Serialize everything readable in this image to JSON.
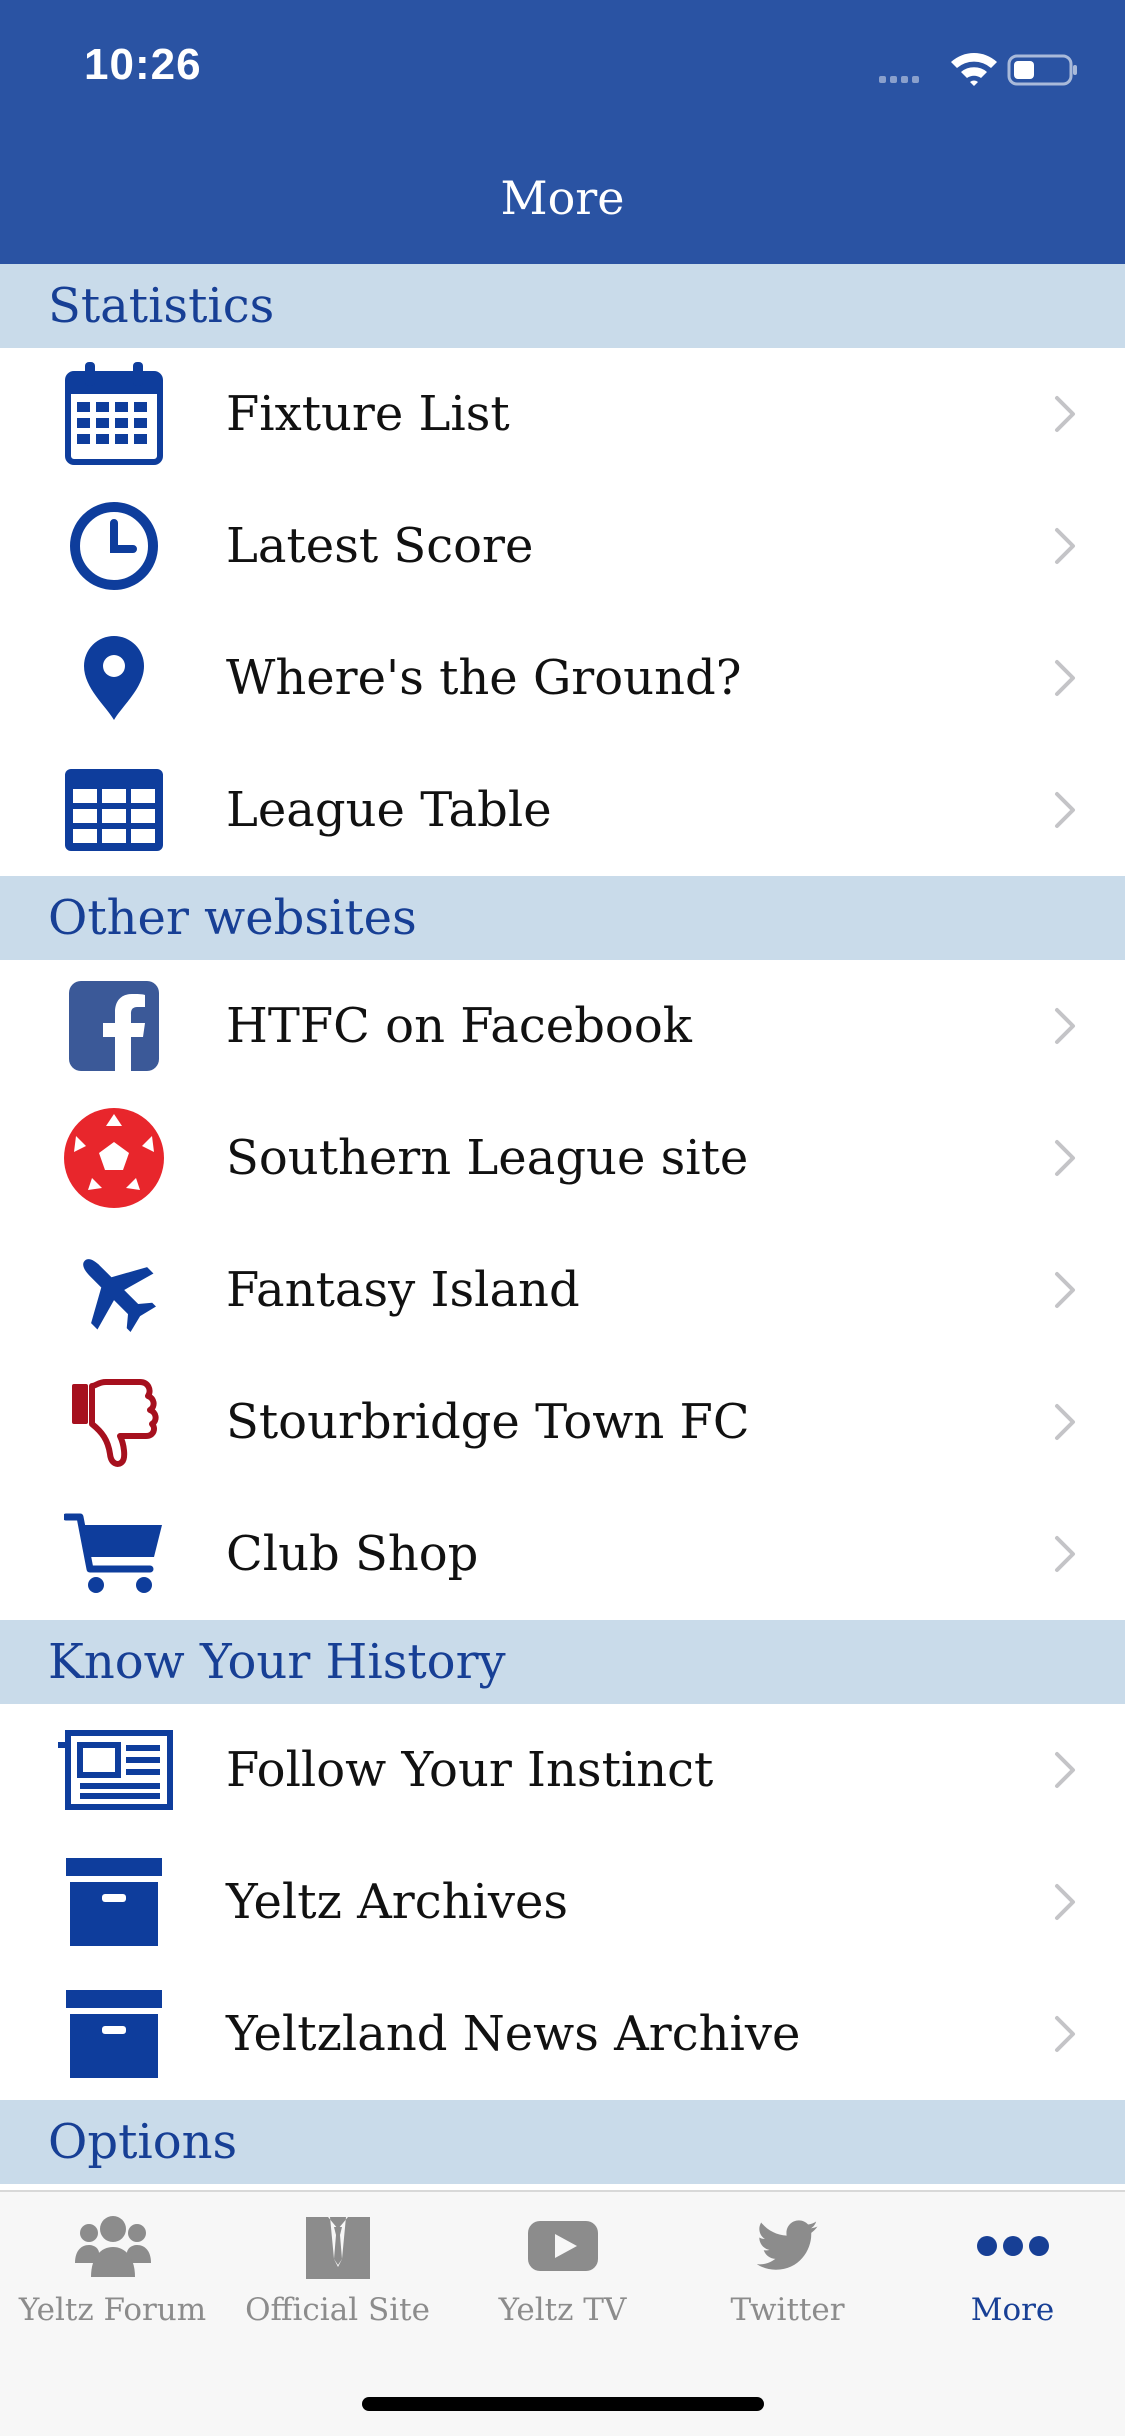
{
  "status_bar": {
    "time": "10:26"
  },
  "nav": {
    "title": "More"
  },
  "sections": [
    {
      "title": "Statistics",
      "items": [
        {
          "label": "Fixture List",
          "icon": "calendar-icon"
        },
        {
          "label": "Latest Score",
          "icon": "clock-icon"
        },
        {
          "label": "Where's the Ground?",
          "icon": "map-pin-icon"
        },
        {
          "label": "League Table",
          "icon": "table-icon"
        }
      ]
    },
    {
      "title": "Other websites",
      "items": [
        {
          "label": "HTFC on Facebook",
          "icon": "facebook-icon"
        },
        {
          "label": "Southern League site",
          "icon": "football-icon"
        },
        {
          "label": "Fantasy Island",
          "icon": "airplane-icon"
        },
        {
          "label": "Stourbridge Town FC",
          "icon": "thumbs-down-icon"
        },
        {
          "label": "Club Shop",
          "icon": "shopping-cart-icon"
        }
      ]
    },
    {
      "title": "Know Your History",
      "items": [
        {
          "label": "Follow Your Instinct",
          "icon": "newspaper-icon"
        },
        {
          "label": "Yeltz Archives",
          "icon": "archive-box-icon"
        },
        {
          "label": "Yeltzland News Archive",
          "icon": "archive-box-icon"
        }
      ]
    },
    {
      "title": "Options",
      "items": []
    }
  ],
  "tabs": [
    {
      "label": "Yeltz Forum",
      "icon": "users-icon",
      "active": false
    },
    {
      "label": "Official Site",
      "icon": "shirt-icon",
      "active": false
    },
    {
      "label": "Yeltz TV",
      "icon": "youtube-icon",
      "active": false
    },
    {
      "label": "Twitter",
      "icon": "twitter-icon",
      "active": false
    },
    {
      "label": "More",
      "icon": "more-dots-icon",
      "active": true
    }
  ],
  "colors": {
    "brand_blue": "#2a53a3",
    "section_bg": "#c9dbea",
    "section_text": "#173f95",
    "icon_blue": "#0e3d9c",
    "icon_red": "#e8262c",
    "icon_dark_red": "#a6101e",
    "facebook_blue": "#3b5998"
  }
}
